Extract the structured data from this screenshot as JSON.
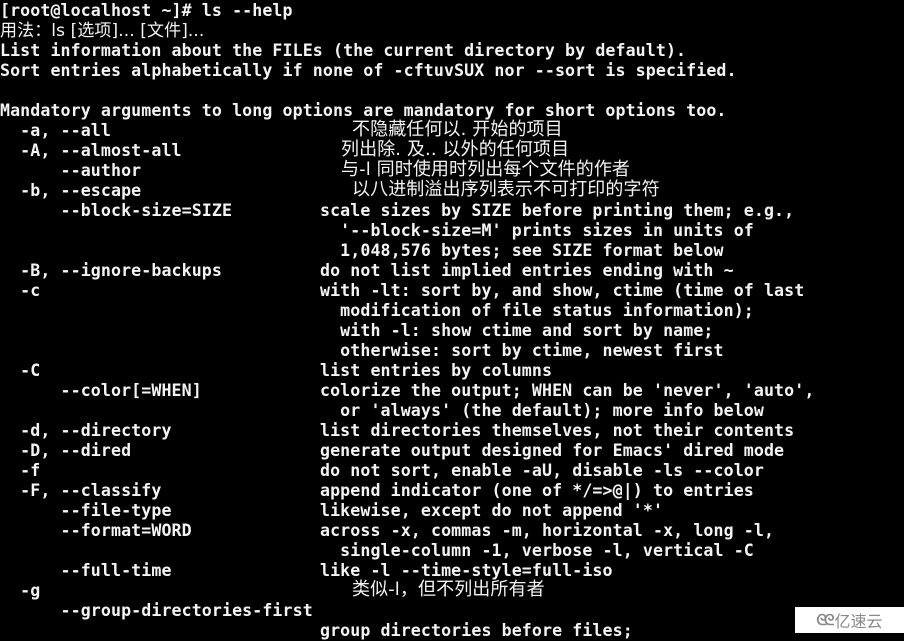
{
  "terminal": {
    "prompt_line": "[root@localhost ~]# ls --help",
    "usage_line": "用法：ls [选项]... [文件]...",
    "desc_lines": [
      "List information about the FILEs (the current directory by default).",
      "Sort entries alphabetically if none of -cftuvSUX nor --sort is specified."
    ],
    "mandatory_line": "Mandatory arguments to long options are mandatory for short options too.",
    "options": [
      {
        "flag": "  -a, --all",
        "desc": "不隐藏任何以. 开始的项目",
        "cjk": true
      },
      {
        "flag": "  -A, --almost-all",
        "desc": "列出除. 及.. 以外的任何项目",
        "cjk": true
      },
      {
        "flag": "      --author",
        "desc": "与-l 同时使用时列出每个文件的作者",
        "cjk": true
      },
      {
        "flag": "  -b, --escape",
        "desc": "以八进制溢出序列表示不可打印的字符",
        "cjk": true
      },
      {
        "flag": "      --block-size=SIZE",
        "desc": "scale sizes by SIZE before printing them; e.g.,"
      },
      {
        "flag": "",
        "desc": "  '--block-size=M' prints sizes in units of"
      },
      {
        "flag": "",
        "desc": "  1,048,576 bytes; see SIZE format below"
      },
      {
        "flag": "  -B, --ignore-backups",
        "desc": "do not list implied entries ending with ~"
      },
      {
        "flag": "  -c",
        "desc": "with -lt: sort by, and show, ctime (time of last"
      },
      {
        "flag": "",
        "desc": "  modification of file status information);"
      },
      {
        "flag": "",
        "desc": "  with -l: show ctime and sort by name;"
      },
      {
        "flag": "",
        "desc": "  otherwise: sort by ctime, newest first"
      },
      {
        "flag": "  -C",
        "desc": "list entries by columns"
      },
      {
        "flag": "      --color[=WHEN]",
        "desc": "colorize the output; WHEN can be 'never', 'auto',"
      },
      {
        "flag": "",
        "desc": "  or 'always' (the default); more info below"
      },
      {
        "flag": "  -d, --directory",
        "desc": "list directories themselves, not their contents"
      },
      {
        "flag": "  -D, --dired",
        "desc": "generate output designed for Emacs' dired mode"
      },
      {
        "flag": "  -f",
        "desc": "do not sort, enable -aU, disable -ls --color"
      },
      {
        "flag": "  -F, --classify",
        "desc": "append indicator (one of */=>@|) to entries"
      },
      {
        "flag": "      --file-type",
        "desc": "likewise, except do not append '*'"
      },
      {
        "flag": "      --format=WORD",
        "desc": "across -x, commas -m, horizontal -x, long -l,"
      },
      {
        "flag": "",
        "desc": "  single-column -1, verbose -l, vertical -C"
      },
      {
        "flag": "      --full-time",
        "desc": "like -l --time-style=full-iso"
      },
      {
        "flag": "  -g",
        "desc": "类似-l，但不列出所有者",
        "cjk": true
      },
      {
        "flag": "      --group-directories-first",
        "desc": ""
      },
      {
        "flag": "",
        "desc": "group directories before files;"
      }
    ]
  },
  "watermark": {
    "logo_icon": "cloud-logo-icon",
    "logo_glyph": "ᘓᘓ",
    "text": "亿速云"
  }
}
